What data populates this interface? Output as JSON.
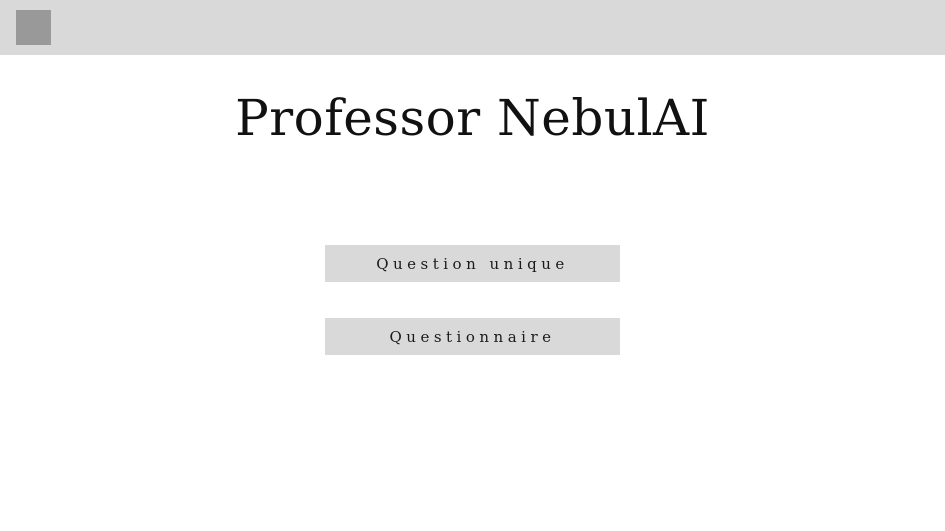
{
  "header": {
    "logo": "gray-square"
  },
  "main": {
    "title": "Professor NebulAI",
    "buttons": {
      "single_question_label": "Question unique",
      "questionnaire_label": "Questionnaire"
    }
  },
  "colors": {
    "topbar": "#d9d9d9",
    "logo": "#999999",
    "button_bg": "#d9d9d9",
    "text": "#111111",
    "background": "#ffffff"
  }
}
